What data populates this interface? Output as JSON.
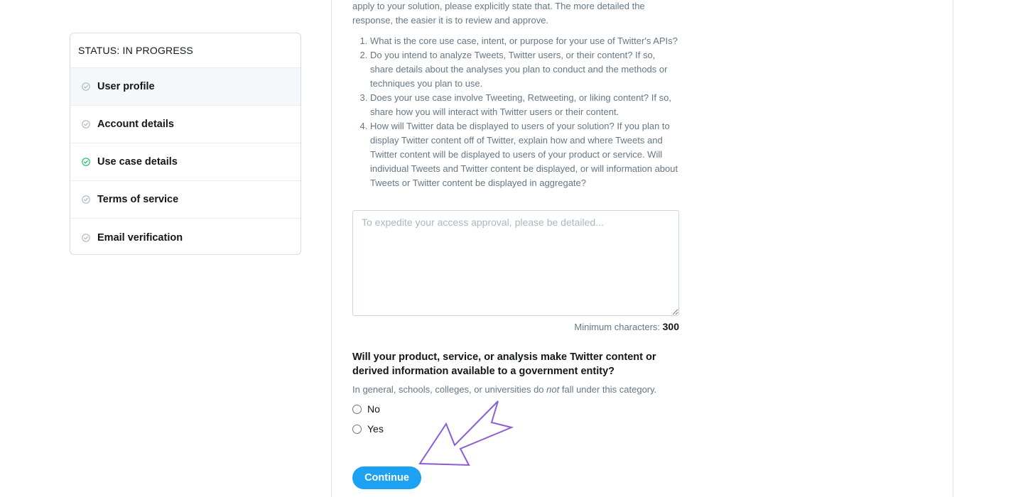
{
  "status": {
    "header": "STATUS: IN PROGRESS",
    "steps": [
      {
        "label": "User profile",
        "icon": "check-circle-icon",
        "complete": false,
        "active": true
      },
      {
        "label": "Account details",
        "icon": "check-circle-icon",
        "complete": false,
        "active": false
      },
      {
        "label": "Use case details",
        "icon": "check-circle-icon",
        "complete": true,
        "active": false
      },
      {
        "label": "Terms of service",
        "icon": "check-circle-icon",
        "complete": false,
        "active": false
      },
      {
        "label": "Email verification",
        "icon": "check-circle-icon",
        "complete": false,
        "active": false
      }
    ]
  },
  "form": {
    "intro": "apply to your solution, please explicitly state that. The more detailed the response, the easier it is to review and approve.",
    "questions": [
      "What is the core use case, intent, or purpose for your use of Twitter's APIs?",
      "Do you intend to analyze Tweets, Twitter users, or their content? If so, share details about the analyses you plan to conduct and the methods or techniques you plan to use.",
      "Does your use case involve Tweeting, Retweeting, or liking content? If so, share how you will interact with Twitter users or their content.",
      "How will Twitter data be displayed to users of your solution? If you plan to display Twitter content off of Twitter, explain how and where Tweets and Twitter content will be displayed to users of your product or service. Will individual Tweets and Twitter content be displayed, or will information about Tweets or Twitter content be displayed in aggregate?"
    ],
    "answer": {
      "value": "",
      "placeholder": "To expedite your access approval, please be detailed..."
    },
    "min_chars_label": "Minimum characters:",
    "min_chars_value": "300",
    "gov_question": "Will your product, service, or analysis make Twitter content or derived information available to a government entity?",
    "gov_note_before": "In general, schools, colleges, or universities do ",
    "gov_note_emphasis": "not",
    "gov_note_after": " fall under this category.",
    "options": [
      "No",
      "Yes"
    ],
    "continue_label": "Continue"
  },
  "colors": {
    "accent": "#1da1f2",
    "complete": "#17bf63",
    "incomplete": "#aab8c2",
    "annotation_arrow": "#8c5bd6"
  }
}
